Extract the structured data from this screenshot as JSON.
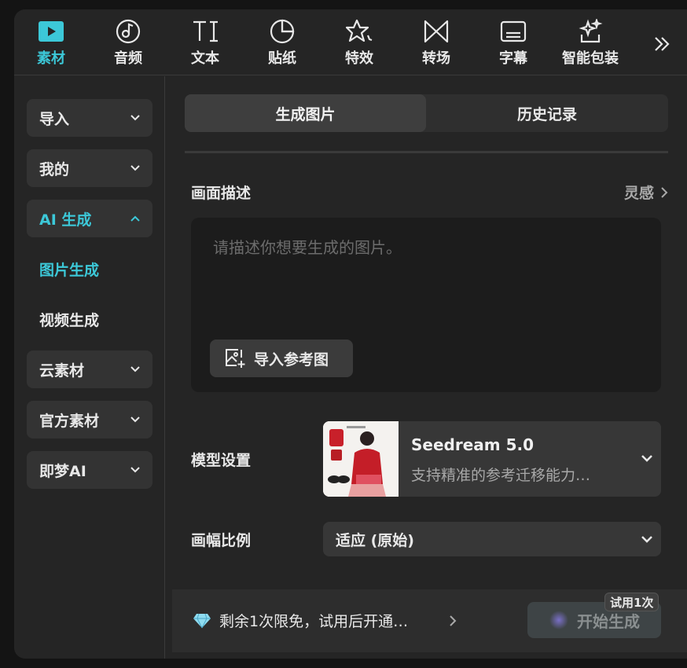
{
  "toolbar": {
    "items": [
      {
        "label": "素材",
        "icon": "media-play-icon",
        "active": true
      },
      {
        "label": "音频",
        "icon": "audio-disc-icon"
      },
      {
        "label": "文本",
        "icon": "text-ti-icon"
      },
      {
        "label": "贴纸",
        "icon": "sticker-icon"
      },
      {
        "label": "特效",
        "icon": "effects-star-icon"
      },
      {
        "label": "转场",
        "icon": "transition-icon"
      },
      {
        "label": "字幕",
        "icon": "subtitle-icon"
      },
      {
        "label": "智能包装",
        "icon": "smart-pack-icon"
      }
    ],
    "more_icon": "double-chevron-right-icon"
  },
  "sidebar": {
    "items": [
      {
        "label": "导入"
      },
      {
        "label": "我的"
      },
      {
        "label": "AI 生成",
        "active": true
      },
      {
        "label": "图片生成",
        "active": true
      },
      {
        "label": "视频生成"
      },
      {
        "label": "云素材"
      },
      {
        "label": "官方素材"
      },
      {
        "label": "即梦AI"
      }
    ]
  },
  "main": {
    "tabs": [
      {
        "label": "生成图片",
        "active": true
      },
      {
        "label": "历史记录"
      }
    ],
    "desc_label": "画面描述",
    "inspiration": "灵感",
    "desc_placeholder": "请描述你想要生成的图片。",
    "import_ref_label": "导入参考图",
    "model_label": "模型设置",
    "model_name": "Seedream 5.0",
    "model_desc": "支持精准的参考迁移能力…",
    "ratio_label": "画幅比例",
    "ratio_value": "适应 (原始)"
  },
  "footer": {
    "free_text": "剩余1次限免，试用后开通…",
    "generate_label": "开始生成",
    "trial_badge": "试用1次"
  },
  "colors": {
    "accent": "#3cc8d8",
    "background": "#252525",
    "panel": "#1c1c1c"
  }
}
